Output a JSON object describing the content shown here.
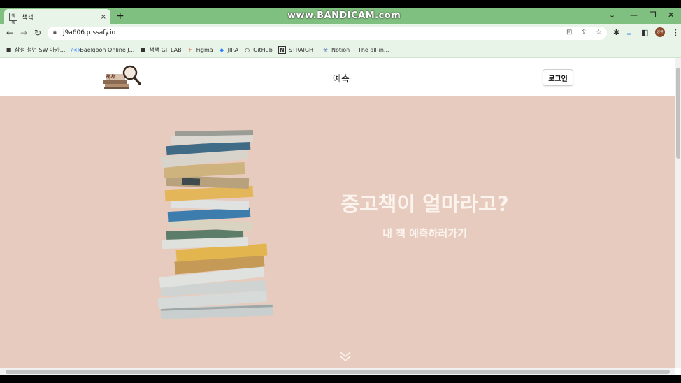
{
  "browser": {
    "tab_title": "책책",
    "tab_favicon": "책책",
    "new_tab": "+",
    "close_tab": "×",
    "watermark": "www.BANDICAM.com",
    "url": "j9a606.p.ssafy.io",
    "profile_avatar": "성규",
    "bookmarks": [
      {
        "label": "삼성 청년 SW 아카...",
        "icon": "■"
      },
      {
        "label": "Baekjoon Online J...",
        "icon": "/<>"
      },
      {
        "label": "책책 GITLAB",
        "icon": "■"
      },
      {
        "label": "Figma",
        "icon": "F"
      },
      {
        "label": "JIRA",
        "icon": "◆"
      },
      {
        "label": "GitHub",
        "icon": "○"
      },
      {
        "label": "STRAIGHT",
        "icon": "N"
      },
      {
        "label": "Notion ~ The all-in...",
        "icon": "❀"
      }
    ]
  },
  "site": {
    "logo_text": "책책",
    "nav_title": "예측",
    "login_label": "로그인"
  },
  "hero": {
    "title": "중고책이 얼마라고?",
    "subtitle": "내 책 예측하러가기"
  },
  "colors": {
    "browser_chrome": "#7fbf7f",
    "hero_background": "#e7cbbe"
  }
}
